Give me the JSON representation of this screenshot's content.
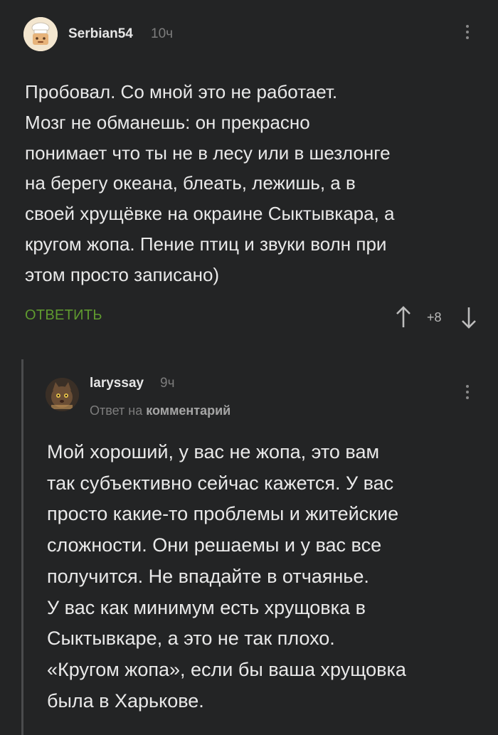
{
  "comment": {
    "username": "Serbian54",
    "time": "10ч",
    "text": "Пробовал. Со мной это не работает.\nМозг не обманешь: он прекрасно\nпонимает что ты не в лесу или в шезлонге\nна берегу океана, блеать, лежишь, а в\nсвоей хрущёвке на окраине Сыктывкара, а\nкругом жопа. Пение птиц и звуки волн при\nэтом просто записано)",
    "reply_label": "ОТВЕТИТЬ",
    "rating": "+8"
  },
  "reply": {
    "username": "laryssay",
    "time": "9ч",
    "reply_prefix": "Ответ на",
    "reply_target": "комментарий",
    "text": "Мой хороший, у вас не жопа, это вам\nтак субъективно сейчас кажется. У вас\nпросто какие-то проблемы и житейские\nсложности. Они решаемы и у вас все\nполучится. Не впадайте в отчаянье.\n У вас как минимум есть хрущовка в\nСыктывкаре, а это не так плохо.\n«Кругом жопа», если бы ваша хрущовка\nбыла в Харькове."
  },
  "colors": {
    "background": "#232425",
    "text": "#e9e9e9",
    "accent_green": "#5f9a2f",
    "muted": "#7d7d7d"
  },
  "icons": [
    "avatar-chef",
    "more-vertical-icon",
    "arrow-up-icon",
    "arrow-down-icon",
    "avatar-cat"
  ]
}
